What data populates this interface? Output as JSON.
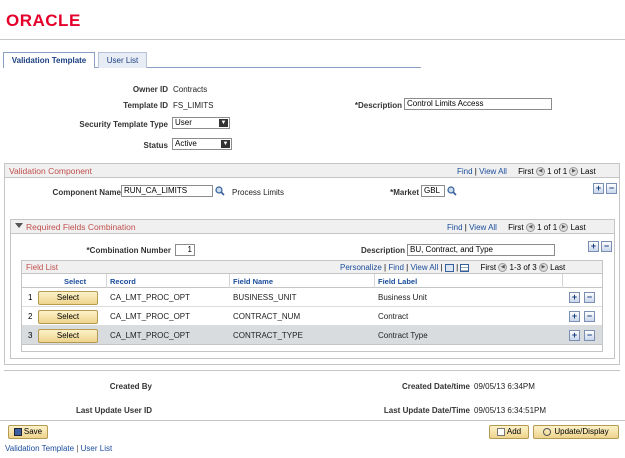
{
  "brand": {
    "logo": "ORACLE"
  },
  "tabs": [
    {
      "label": "Validation Template",
      "active": true
    },
    {
      "label": "User List",
      "active": false
    }
  ],
  "header": {
    "owner_id_label": "Owner ID",
    "owner_id": "Contracts",
    "template_id_label": "Template ID",
    "template_id": "FS_LIMITS",
    "description_label": "*Description",
    "description": "Control Limits Access",
    "security_label": "Security Template Type",
    "security_value": "User",
    "status_label": "Status",
    "status_value": "Active"
  },
  "validation_component": {
    "title": "Validation Component",
    "find": "Find",
    "view_all": "View All",
    "first": "First",
    "range": "1 of 1",
    "last": "Last",
    "component_label": "Component Name",
    "component": "RUN_CA_LIMITS",
    "component_desc": "Process Limits",
    "market_label": "*Market",
    "market": "GBL"
  },
  "required_fields": {
    "title": "Required Fields Combination",
    "find": "Find",
    "view_all": "View All",
    "first": "First",
    "range": "1 of 1",
    "last": "Last",
    "combo_label": "*Combination Number",
    "combo": "1",
    "desc_label": "Description",
    "desc": "BU, Contract, and Type"
  },
  "field_list": {
    "title": "Field List",
    "personalize": "Personalize",
    "find": "Find",
    "view_all": "View All",
    "first": "First",
    "range": "1-3 of 3",
    "last": "Last",
    "columns": [
      "Select",
      "Record",
      "Field Name",
      "Field Label"
    ],
    "rows": [
      {
        "num": "1",
        "select": "Select",
        "record": "CA_LMT_PROC_OPT",
        "field_name": "BUSINESS_UNIT",
        "field_label": "Business Unit"
      },
      {
        "num": "2",
        "select": "Select",
        "record": "CA_LMT_PROC_OPT",
        "field_name": "CONTRACT_NUM",
        "field_label": "Contract"
      },
      {
        "num": "3",
        "select": "Select",
        "record": "CA_LMT_PROC_OPT",
        "field_name": "CONTRACT_TYPE",
        "field_label": "Contract Type"
      }
    ]
  },
  "audit": {
    "created_by_label": "Created By",
    "created_dt_label": "Created Date/time",
    "created_dt": "09/05/13  6:34PM",
    "last_update_label": "Last Update User ID",
    "last_update_dt_label": "Last Update Date/Time",
    "last_update_dt": "09/05/13  6:34:51PM"
  },
  "toolbar": {
    "save": "Save",
    "add": "Add",
    "update": "Update/Display"
  },
  "footer_links": [
    "Validation Template",
    "User List"
  ],
  "footer_sep": "|",
  "colors": {
    "brand": "#e4002b",
    "section_title": "#c0504d",
    "link": "#1a4c9a"
  }
}
